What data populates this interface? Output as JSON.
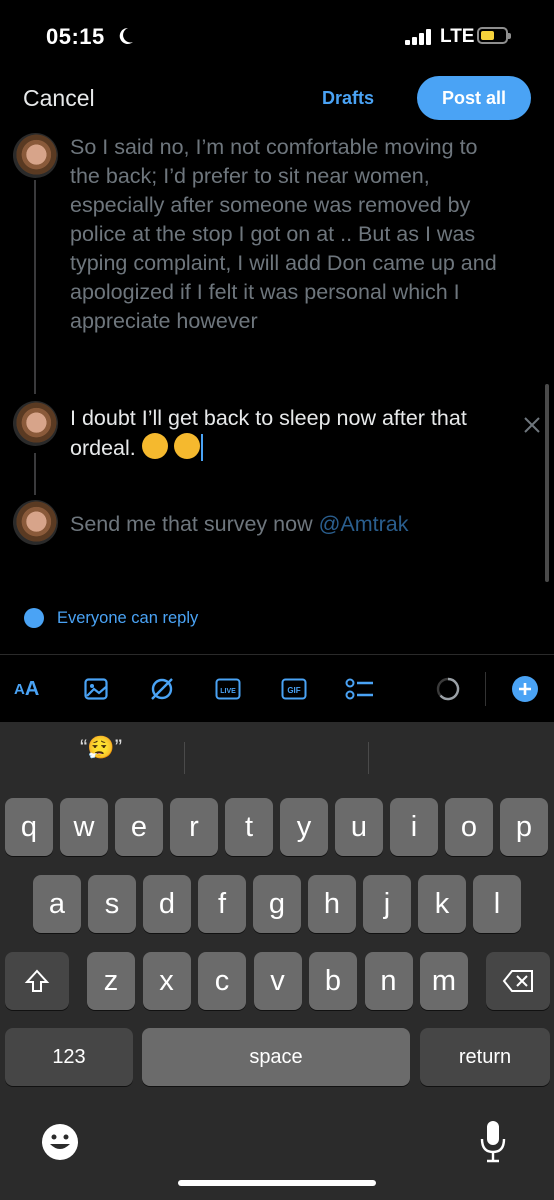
{
  "status_bar": {
    "time": "05:15",
    "network": "LTE"
  },
  "header": {
    "cancel_label": "Cancel",
    "drafts_label": "Drafts",
    "post_all_label": "Post all"
  },
  "thread": {
    "tweets": [
      {
        "text": "So I said no, I’m not comfortable moving to the back; I’d prefer to sit near women, especially after someone was removed by police at the stop I got on at .. But as I was typing complaint, I will add Don came up and apologized if I felt it was personal which I appreciate however"
      },
      {
        "text": "I doubt I’ll get back to sleep now after that ordeal."
      },
      {
        "text": "Send me that survey now ",
        "mention": "@Amtrak"
      }
    ]
  },
  "reply_setting": {
    "label": "Everyone can reply"
  },
  "toolbar": {
    "text_size_label": "A",
    "text_size_label_small": "A"
  },
  "keyboard": {
    "suggestion": "“😮‍💨”",
    "rows": [
      [
        "q",
        "w",
        "e",
        "r",
        "t",
        "y",
        "u",
        "i",
        "o",
        "p"
      ],
      [
        "a",
        "s",
        "d",
        "f",
        "g",
        "h",
        "j",
        "k",
        "l"
      ],
      [
        "z",
        "x",
        "c",
        "v",
        "b",
        "n",
        "m"
      ]
    ],
    "numbers_label": "123",
    "space_label": "space",
    "return_label": "return"
  },
  "colors": {
    "accent": "#4aa3f5",
    "background": "#000000",
    "keyboard": "#2b2b2b",
    "key": "#6b6b6b"
  }
}
